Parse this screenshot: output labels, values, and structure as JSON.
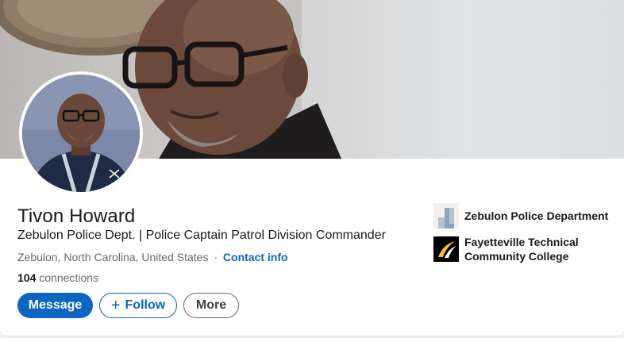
{
  "profile": {
    "name": "Tivon Howard",
    "headline": "Zebulon Police Dept. | Police Captain Patrol Division Commander",
    "location": "Zebulon, North Carolina, United States",
    "separator": "·",
    "contact_info_label": "Contact info",
    "connections_count": "104",
    "connections_label": "connections"
  },
  "actions": {
    "message_label": "Message",
    "follow_label": "Follow",
    "follow_icon": "+",
    "more_label": "More"
  },
  "organizations": [
    {
      "name": "Zebulon Police Department",
      "icon": "building-logo-placeholder"
    },
    {
      "name": "Fayetteville Technical Community College",
      "icon": "ftcc-logo"
    }
  ],
  "colors": {
    "accent": "#0a66c2",
    "text_primary": "#191919",
    "text_secondary": "#666666"
  }
}
